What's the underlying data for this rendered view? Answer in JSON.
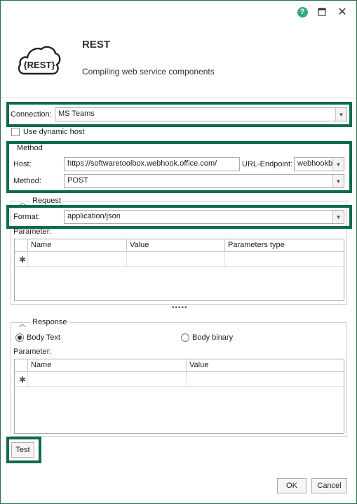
{
  "window": {
    "help_icon": "help-icon",
    "maximize_icon": "maximize-icon",
    "close_icon": "close-icon",
    "close_glyph": "✕",
    "help_glyph": "?"
  },
  "header": {
    "logo_text": "{REST}",
    "title": "REST",
    "subtitle": "Compiling web service components"
  },
  "connection": {
    "label": "Connection:",
    "value": "MS Teams",
    "use_dynamic_host_label": "Use dynamic host",
    "use_dynamic_host_checked": false
  },
  "method_group": {
    "title": "Method",
    "host_label": "Host:",
    "host_value": "https://softwaretoolbox.webhook.office.com/",
    "url_endpoint_label": "URL-Endpoint:",
    "url_endpoint_value": "webhookb",
    "method_label": "Method:",
    "method_value": "POST"
  },
  "request_group": {
    "title": "Request",
    "format_label": "Format:",
    "format_value": "application/json",
    "parameter_label": "Parameter:",
    "columns": [
      "Name",
      "Value",
      "Parameters type"
    ],
    "new_row_glyph": "✱"
  },
  "splitter": "•••••",
  "response_group": {
    "title": "Response",
    "body_text_label": "Body Text",
    "body_binary_label": "Body binary",
    "selected": "Body Text",
    "parameter_label": "Parameter:",
    "columns": [
      "Name",
      "Value"
    ],
    "new_row_glyph": "✱"
  },
  "buttons": {
    "test": "Test",
    "ok": "OK",
    "cancel": "Cancel"
  },
  "colors": {
    "highlight": "#0d6b4c",
    "help": "#3aa77b"
  }
}
